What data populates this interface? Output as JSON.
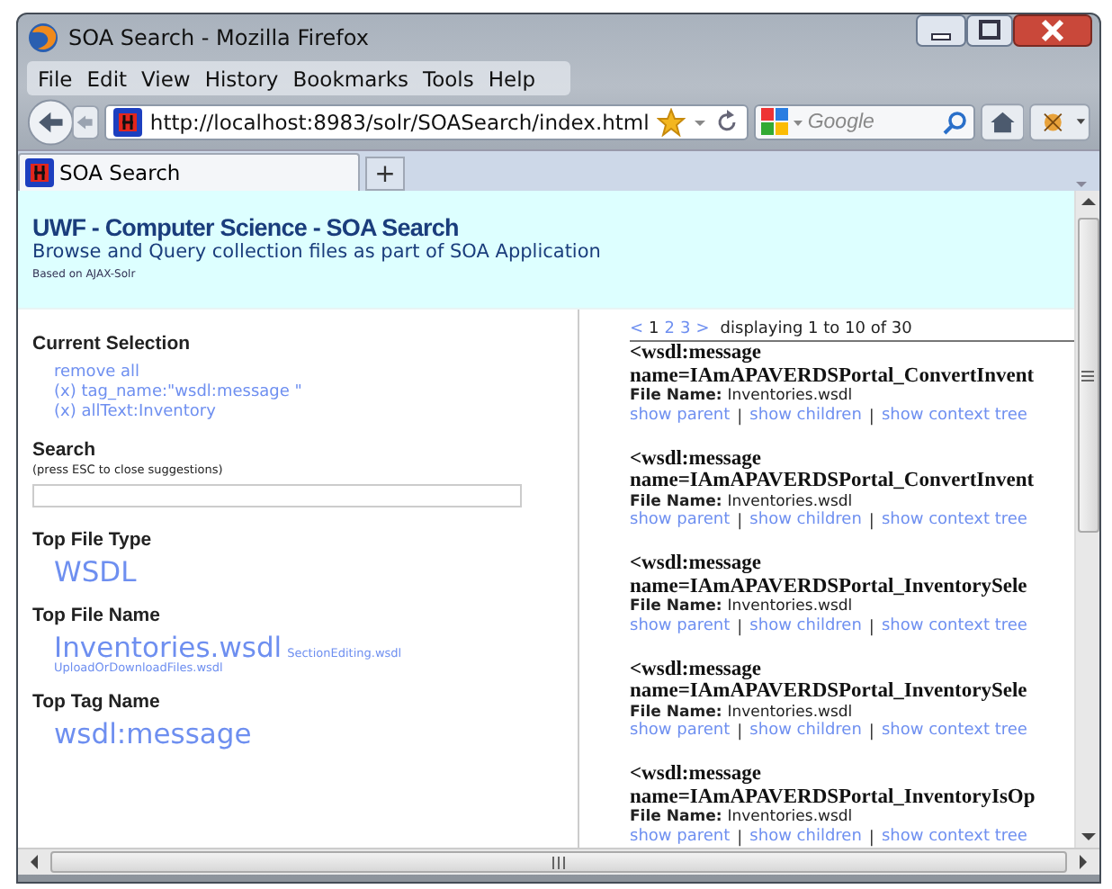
{
  "window": {
    "title": "SOA Search - Mozilla Firefox"
  },
  "menu": [
    "File",
    "Edit",
    "View",
    "History",
    "Bookmarks",
    "Tools",
    "Help"
  ],
  "address_bar": {
    "url": "http://localhost:8983/solr/SOASearch/index.html"
  },
  "search_box": {
    "placeholder": "Google"
  },
  "tabs": [
    {
      "label": "SOA Search",
      "selected": true
    }
  ],
  "new_tab": "+",
  "page": {
    "title": "UWF - Computer Science - SOA Search",
    "subtitle": "Browse and Query collection files as part of SOA Application",
    "credit": "Based on AJAX-Solr"
  },
  "current_selection": {
    "heading": "Current Selection",
    "items": [
      "remove all",
      "(x) tag_name:\"wsdl:message \"",
      "(x) allText:Inventory"
    ]
  },
  "search": {
    "heading": "Search",
    "hint": "(press ESC to close suggestions)"
  },
  "facets": [
    {
      "heading": "Top File Type",
      "items": [
        {
          "label": "WSDL",
          "kind": "large"
        }
      ]
    },
    {
      "heading": "Top File Name",
      "items": [
        {
          "label": "Inventories.wsdl",
          "kind": "large"
        },
        {
          "label": "SectionEditing.wsdl",
          "kind": "small"
        },
        {
          "label": "UploadOrDownloadFiles.wsdl",
          "kind": "small"
        }
      ]
    },
    {
      "heading": "Top Tag Name",
      "items": [
        {
          "label": "wsdl:message",
          "kind": "large"
        }
      ]
    }
  ],
  "pager": {
    "prev": "<",
    "pages": [
      {
        "label": "1",
        "selected": true
      },
      {
        "label": "2",
        "selected": false
      },
      {
        "label": "3",
        "selected": false
      }
    ],
    "next": ">",
    "summary": "displaying 1 to 10 of 30"
  },
  "results": [
    {
      "tag": "<wsdl:message",
      "name": "name=IAmAPAVERDSPortal_ConvertInvent",
      "file_label": "File Name:",
      "file": "Inventories.wsdl",
      "separator": "|",
      "links": [
        "show parent",
        "show children",
        "show context tree"
      ]
    },
    {
      "tag": "<wsdl:message",
      "name": "name=IAmAPAVERDSPortal_ConvertInvent",
      "file_label": "File Name:",
      "file": "Inventories.wsdl",
      "separator": "|",
      "links": [
        "show parent",
        "show children",
        "show context tree"
      ]
    },
    {
      "tag": "<wsdl:message",
      "name": "name=IAmAPAVERDSPortal_InventorySele",
      "file_label": "File Name:",
      "file": "Inventories.wsdl",
      "separator": "|",
      "links": [
        "show parent",
        "show children",
        "show context tree"
      ]
    },
    {
      "tag": "<wsdl:message",
      "name": "name=IAmAPAVERDSPortal_InventorySele",
      "file_label": "File Name:",
      "file": "Inventories.wsdl",
      "separator": "|",
      "links": [
        "show parent",
        "show children",
        "show context tree"
      ]
    },
    {
      "tag": "<wsdl:message",
      "name": "name=IAmAPAVERDSPortal_InventoryIsOp",
      "file_label": "File Name:",
      "file": "Inventories.wsdl",
      "separator": "|",
      "links": [
        "show parent",
        "show children",
        "show context tree"
      ]
    }
  ]
}
